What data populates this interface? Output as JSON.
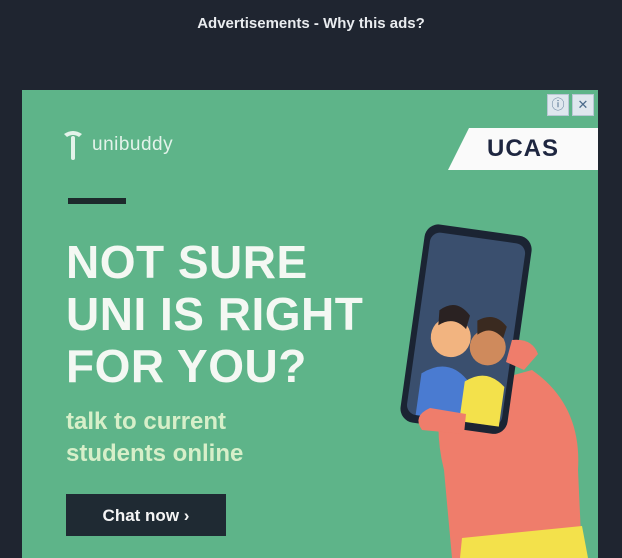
{
  "header": {
    "label": "Advertisements",
    "separator": " - ",
    "why_link": "Why this ads?"
  },
  "ad": {
    "controls": {
      "info_icon": "ⓘ",
      "close_icon": "✕"
    },
    "brand": "unibuddy",
    "partner": "UCAS",
    "headline": [
      "NOT SURE",
      "UNI IS RIGHT",
      "FOR YOU?"
    ],
    "subhead": [
      "talk to current",
      "students online"
    ],
    "cta": "Chat now ›",
    "colors": {
      "page_bg": "#1f2530",
      "ad_bg": "#5eb489",
      "headline": "#f4f8f3",
      "subhead": "#d7efc9",
      "cta_bg": "#1f2a33",
      "hand": "#ef7d6b",
      "sleeve": "#f3e14b"
    },
    "icons": [
      "info-icon",
      "close-icon",
      "unibuddy-logo-icon",
      "phone-illustration"
    ]
  }
}
